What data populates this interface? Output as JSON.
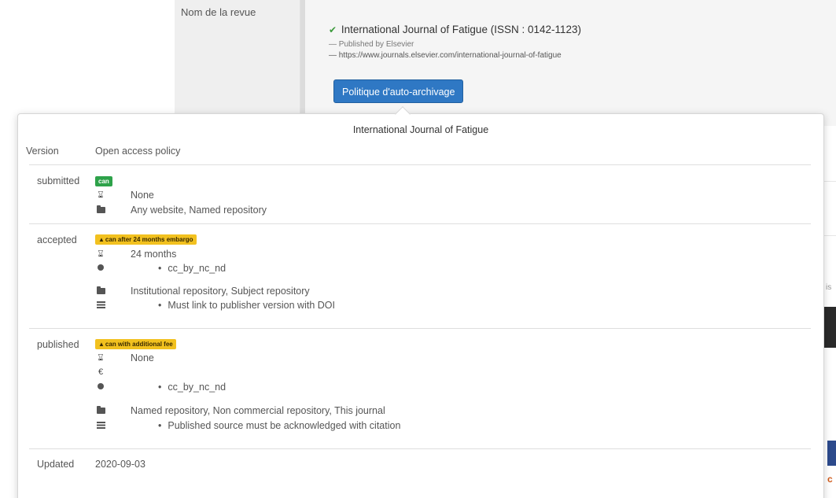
{
  "form": {
    "field_label": "Nom de la revue",
    "journal_title": "International Journal of Fatigue (ISSN : 0142-1123)",
    "published_by": "— Published by Elsevier",
    "url": "— https://www.journals.elsevier.com/international-journal-of-fatigue",
    "policy_button": "Politique d'auto-archivage"
  },
  "popover": {
    "title": "International Journal of Fatigue",
    "header": {
      "version": "Version",
      "policy": "Open access policy"
    },
    "submitted": {
      "version": "submitted",
      "badge": "can",
      "embargo": "None",
      "locations": "Any website, Named repository"
    },
    "accepted": {
      "version": "accepted",
      "badge": "can after 24 months embargo",
      "embargo": "24 months",
      "license": "cc_by_nc_nd",
      "locations": "Institutional repository, Subject repository",
      "condition": "Must link to publisher version with DOI"
    },
    "published": {
      "version": "published",
      "badge": "can with additional fee",
      "embargo": "None",
      "fee_symbol": "€",
      "license": "cc_by_nc_nd",
      "locations": "Named repository, Non commercial repository, This journal",
      "condition": "Published source must be acknowledged with citation"
    },
    "updated": {
      "label": "Updated",
      "date": "2020-09-03"
    }
  },
  "icons": {
    "check": "check-circle-icon",
    "warning": "warning-icon",
    "embargo": "hourglass-icon",
    "fee": "euro-icon",
    "license": "license-dot-icon",
    "location": "folder-icon",
    "condition": "list-icon"
  },
  "colors": {
    "button_blue": "#2f78c4",
    "badge_green": "#2ea24a",
    "badge_yellow": "#f2c11f",
    "check_green": "#3c9a3c"
  }
}
